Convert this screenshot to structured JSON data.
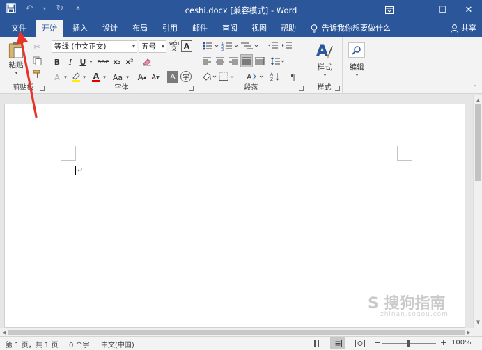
{
  "window": {
    "title": "ceshi.docx [兼容模式] - Word",
    "minimize": "—",
    "maximize": "☐",
    "close": "✕",
    "restore": "⧉"
  },
  "qat": {
    "save": "💾",
    "undo": "↶",
    "redo": "↻",
    "more": "₹"
  },
  "tabs": [
    {
      "label": "文件"
    },
    {
      "label": "开始"
    },
    {
      "label": "插入"
    },
    {
      "label": "设计"
    },
    {
      "label": "布局"
    },
    {
      "label": "引用"
    },
    {
      "label": "邮件"
    },
    {
      "label": "审阅"
    },
    {
      "label": "视图"
    },
    {
      "label": "帮助"
    }
  ],
  "tell_me": "告诉我你想要做什么",
  "share": "共享",
  "ribbon": {
    "clipboard": {
      "label": "剪贴板",
      "paste": "粘贴"
    },
    "font": {
      "label": "字体",
      "font_name": "等线 (中文正文)",
      "font_size": "五号",
      "bold": "B",
      "italic": "I",
      "underline": "U",
      "strike": "abc",
      "sub": "x₂",
      "sup": "x²",
      "grow": "A",
      "shrink": "A",
      "clear": "A",
      "case": "Aa",
      "wen": "wén",
      "wen2": "文"
    },
    "paragraph": {
      "label": "段落"
    },
    "styles": {
      "label": "样式",
      "button": "样式"
    },
    "editing": {
      "button": "编辑"
    }
  },
  "document": {
    "paragraph_mark": "↵"
  },
  "status": {
    "page": "第 1 页，共 1 页",
    "words": "0 个字",
    "lang": "中文(中国)",
    "zoom": "100%",
    "zoom_minus": "−",
    "zoom_plus": "+"
  },
  "watermark": {
    "text": "S 搜狗指南",
    "sub": "zhinan.sogou.com"
  },
  "colors": {
    "accent": "#2b579a",
    "arrow": "#e8332a"
  }
}
